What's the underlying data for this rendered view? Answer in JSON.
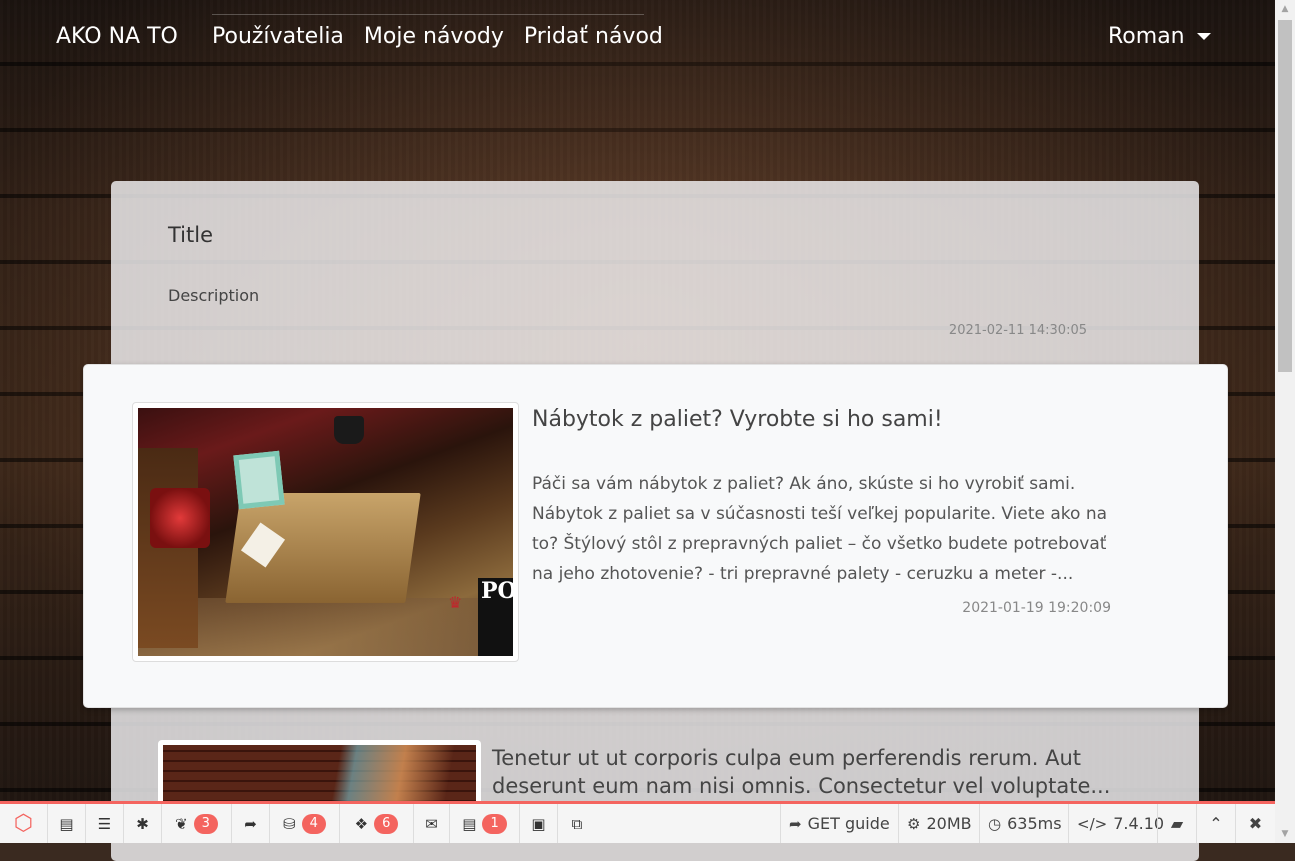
{
  "navbar": {
    "brand": "AKO NA TO",
    "links": [
      "Používatelia",
      "Moje návody",
      "Pridať návod"
    ],
    "user": "Roman"
  },
  "guide": {
    "title": "Title",
    "description": "Description",
    "date": "2021-02-11 14:30:05"
  },
  "featured": {
    "title": "Nábytok z paliet? Vyrobte si ho sami!",
    "excerpt": "Páči sa vám nábytok z paliet? Ak áno, skúste si ho vyrobiť sami. Nábytok z paliet sa v súčasnosti teší veľkej popularite. Viete ako na to? Štýlový stôl z prepravných paliet – čo všetko budete potrebovať na jeho zhotovenie? - tri prepravné palety - ceruzku a meter -...",
    "date": "2021-01-19 19:20:09",
    "image_text": "PO"
  },
  "second": {
    "title": "Tenetur ut ut corporis culpa eum perferendis rerum. Aut deserunt eum nam nisi omnis. Consectetur vel voluptate..."
  },
  "debugbar": {
    "views_count": "3",
    "queries_count": "4",
    "models_count": "6",
    "gates_count": "1",
    "route": "GET guide",
    "memory": "20MB",
    "time": "635ms",
    "php_version": "7.4.10",
    "accent": "#f4645f"
  }
}
